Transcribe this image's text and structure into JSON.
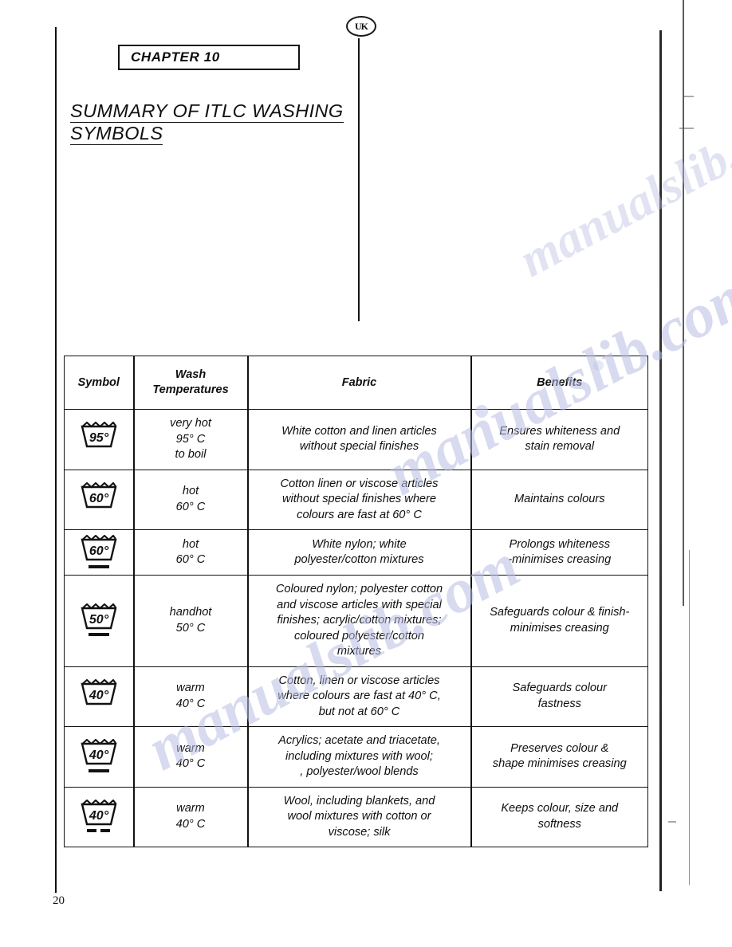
{
  "page": {
    "region_badge": "UK",
    "chapter_label": "CHAPTER 10",
    "title_line1": "SUMMARY OF ITLC WASHING",
    "title_line2": "SYMBOLS",
    "page_number": "20",
    "watermark_text": "manualslib.com"
  },
  "table": {
    "headers": {
      "symbol": "Symbol",
      "temperature": "Wash\nTemperatures",
      "fabric": "Fabric",
      "benefits": "Benefits"
    },
    "rows": [
      {
        "symbol": {
          "icon": "wash-tub-icon",
          "temp_label": "95°",
          "bars": 0
        },
        "temperature": "very hot\n95° C\nto boil",
        "fabric": "White cotton and linen articles\nwithout special finishes",
        "benefits": "Ensures whiteness and\nstain removal"
      },
      {
        "symbol": {
          "icon": "wash-tub-icon",
          "temp_label": "60°",
          "bars": 0
        },
        "temperature": "hot\n60° C",
        "fabric": "Cotton linen or viscose articles\nwithout special finishes where\ncolours are fast at 60° C",
        "benefits": "Maintains colours"
      },
      {
        "symbol": {
          "icon": "wash-tub-icon",
          "temp_label": "60°",
          "bars": 1
        },
        "temperature": "hot\n60° C",
        "fabric": "White nylon; white\npolyester/cotton mixtures",
        "benefits": "Prolongs whiteness\n-minimises creasing"
      },
      {
        "symbol": {
          "icon": "wash-tub-icon",
          "temp_label": "50°",
          "bars": 1
        },
        "temperature": "handhot\n50° C",
        "fabric": "Coloured nylon; polyester cotton\nand viscose articles with special\nfinishes; acrylic/cotton mixtures;\ncoloured polyester/cotton\nmixtures",
        "benefits": "Safeguards colour & finish-\nminimises creasing"
      },
      {
        "symbol": {
          "icon": "wash-tub-icon",
          "temp_label": "40°",
          "bars": 0
        },
        "temperature": "warm\n40° C",
        "fabric": "Cotton, linen or viscose articles\nwhere colours are fast at 40° C,\nbut not at 60° C",
        "benefits": "Safeguards colour\nfastness"
      },
      {
        "symbol": {
          "icon": "wash-tub-icon",
          "temp_label": "40°",
          "bars": 1
        },
        "temperature": "warm\n40° C",
        "fabric": "Acrylics; acetate and triacetate,\nincluding mixtures with wool;\n, polyester/wool blends",
        "benefits": "Preserves colour &\nshape minimises creasing"
      },
      {
        "symbol": {
          "icon": "wash-tub-icon",
          "temp_label": "40°",
          "bars": 2
        },
        "temperature": "warm\n40° C",
        "fabric": "Wool, including blankets, and\nwool mixtures with cotton or\nviscose; silk",
        "benefits": "Keeps colour, size and\nsoftness"
      }
    ]
  }
}
